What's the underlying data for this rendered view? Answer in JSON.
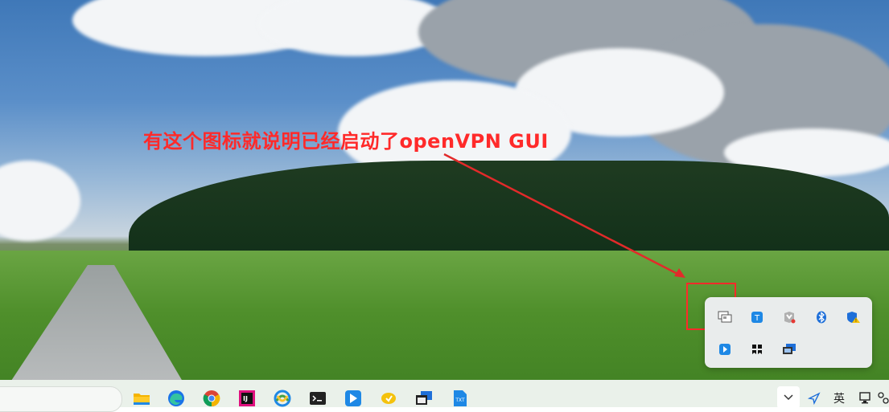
{
  "annotation": {
    "text": "有这个图标就说明已经启动了openVPN GUI",
    "color": "#ff2a2a"
  },
  "tray_flyout": {
    "icons": [
      {
        "name": "openvpn-gui-icon",
        "desc": "openvpn-gui"
      },
      {
        "name": "lightning-app-icon",
        "desc": "app"
      },
      {
        "name": "mcafee-icon",
        "desc": "mcafee"
      },
      {
        "name": "bluetooth-icon",
        "desc": "bluetooth"
      },
      {
        "name": "defender-shield-icon",
        "desc": "windows-security"
      },
      {
        "name": "arrow-app-icon",
        "desc": "app"
      },
      {
        "name": "black-app-icon",
        "desc": "app"
      },
      {
        "name": "display-icon",
        "desc": "display"
      }
    ]
  },
  "taskbar": {
    "apps": [
      "file-explorer",
      "edge",
      "chrome",
      "intellij",
      "app",
      "terminal",
      "feishu",
      "app",
      "window",
      "txt-file"
    ],
    "system": {
      "input_method": "英"
    }
  }
}
